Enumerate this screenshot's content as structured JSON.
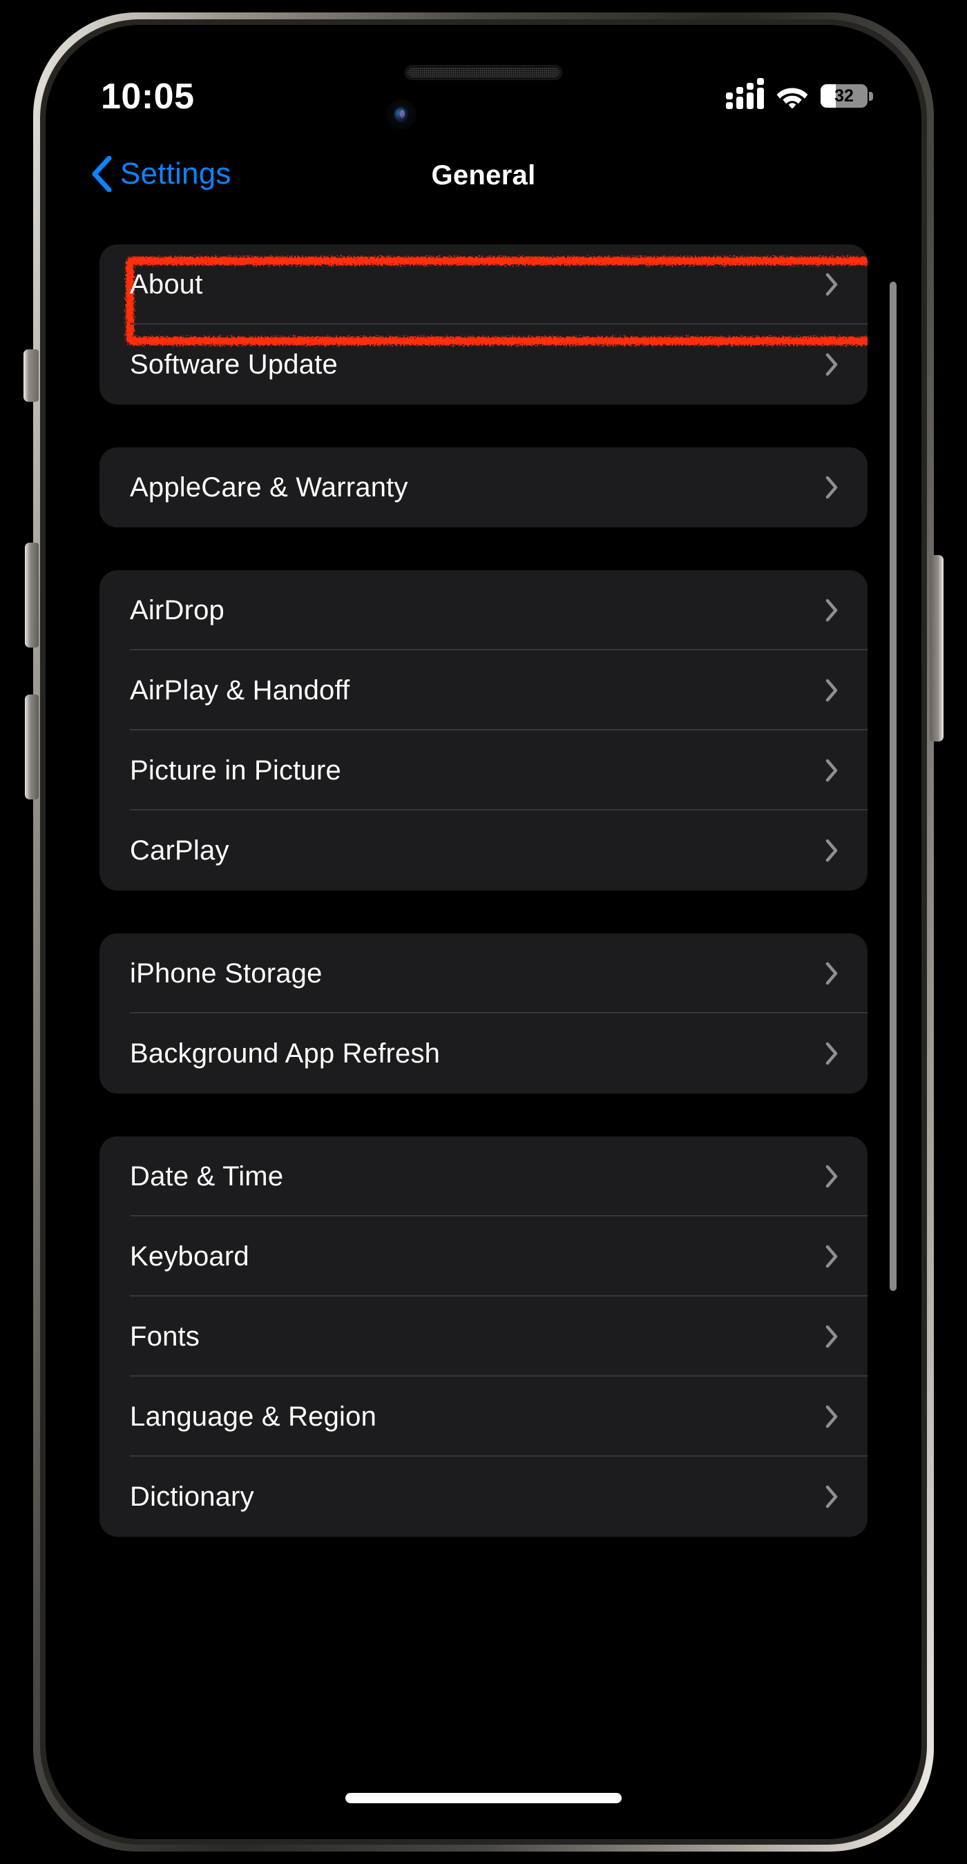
{
  "device": {
    "frame": "iphone",
    "side_buttons": [
      "action-button",
      "volume-up-button",
      "volume-down-button",
      "power-button"
    ]
  },
  "status_bar": {
    "time": "10:05",
    "cellular_icon": "cellular-signal-icon",
    "cellular_bars": 4,
    "wifi_icon": "wifi-icon",
    "battery_icon": "battery-icon",
    "battery_percent": "32",
    "battery_level": 32
  },
  "nav_bar": {
    "back_icon": "chevron-left-icon",
    "back_label": "Settings",
    "title": "General"
  },
  "annotation": {
    "type": "highlight-rectangle",
    "color": "#ff2d0a",
    "target": "About"
  },
  "colors": {
    "background": "#000000",
    "group_background": "#1c1c1e",
    "separator": "#38383a",
    "accent_blue": "#0a84ff",
    "label": "#ffffff",
    "chevron": "#8e8e93",
    "annotation_red": "#ff2d0a"
  },
  "groups": [
    {
      "rows": [
        {
          "label": "About",
          "chevron": "chevron-right-icon",
          "highlighted": true
        },
        {
          "label": "Software Update",
          "chevron": "chevron-right-icon",
          "highlighted": false
        }
      ]
    },
    {
      "rows": [
        {
          "label": "AppleCare & Warranty",
          "chevron": "chevron-right-icon",
          "highlighted": false
        }
      ]
    },
    {
      "rows": [
        {
          "label": "AirDrop",
          "chevron": "chevron-right-icon",
          "highlighted": false
        },
        {
          "label": "AirPlay & Handoff",
          "chevron": "chevron-right-icon",
          "highlighted": false
        },
        {
          "label": "Picture in Picture",
          "chevron": "chevron-right-icon",
          "highlighted": false
        },
        {
          "label": "CarPlay",
          "chevron": "chevron-right-icon",
          "highlighted": false
        }
      ]
    },
    {
      "rows": [
        {
          "label": "iPhone Storage",
          "chevron": "chevron-right-icon",
          "highlighted": false
        },
        {
          "label": "Background App Refresh",
          "chevron": "chevron-right-icon",
          "highlighted": false
        }
      ]
    },
    {
      "rows": [
        {
          "label": "Date & Time",
          "chevron": "chevron-right-icon",
          "highlighted": false
        },
        {
          "label": "Keyboard",
          "chevron": "chevron-right-icon",
          "highlighted": false
        },
        {
          "label": "Fonts",
          "chevron": "chevron-right-icon",
          "highlighted": false
        },
        {
          "label": "Language & Region",
          "chevron": "chevron-right-icon",
          "highlighted": false
        },
        {
          "label": "Dictionary",
          "chevron": "chevron-right-icon",
          "highlighted": false
        }
      ]
    }
  ],
  "home_indicator": "home-indicator"
}
